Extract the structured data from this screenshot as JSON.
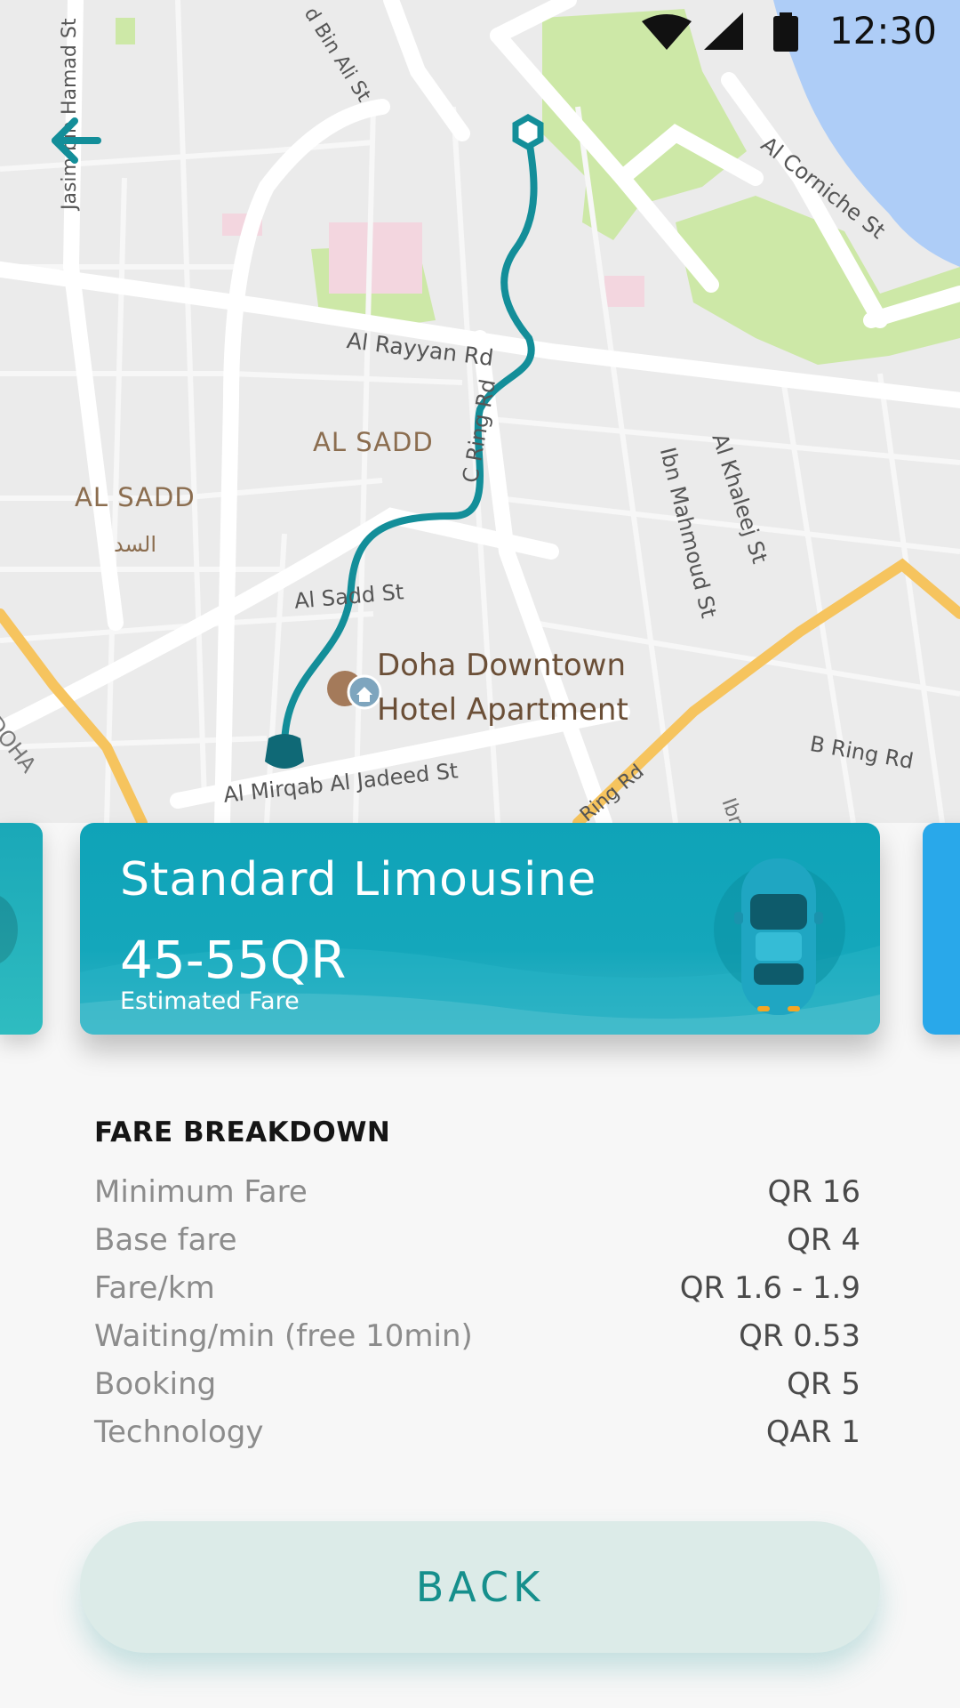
{
  "status": {
    "time": "12:30"
  },
  "map": {
    "labels": {
      "al_sadd_1": "AL SADD",
      "al_sadd_2": "AL SADD",
      "al_sadd_ar": "السد",
      "al_rayyan_rd": "Al Rayyan Rd",
      "al_sadd_st": "Al Sadd St",
      "c_ring_rd": "C Ring Rd",
      "ibn_mahmoud_st": "Ibn Mahmoud St",
      "al_khaleej_st": "Al Khaleej St",
      "al_corniche_st": "Al Corniche St",
      "b_ring_rd": "B Ring Rd",
      "al_mirqab": "Al Mirqab Al Jadeed St",
      "jasim_st": "Jasim bin Hamad St",
      "bin_ali_st": "d Bin Ali St",
      "doha": "DOHA",
      "poi_line1": "Doha Downtown",
      "poi_line2": "Hotel Apartment",
      "ring_rd_partial": "Ring Rd",
      "ibn_partial": "Ibn"
    },
    "colors": {
      "route": "#138e99",
      "park": "#cde8a7",
      "water": "#aecdf7",
      "major_road": "#f6c45e"
    }
  },
  "ride": {
    "title": "Standard Limousine",
    "price": "45-55QR",
    "subtitle": "Estimated Fare",
    "color": "#0fa3b8"
  },
  "breakdown": {
    "title": "FARE BREAKDOWN",
    "rows": [
      {
        "label": "Minimum Fare",
        "value": "QR 16"
      },
      {
        "label": "Base fare",
        "value": "QR 4"
      },
      {
        "label": "Fare/km",
        "value": "QR 1.6 - 1.9"
      },
      {
        "label": "Waiting/min (free 10min)",
        "value": "QR 0.53"
      },
      {
        "label": "Booking",
        "value": "QR 5"
      },
      {
        "label": "Technology",
        "value": "QAR 1"
      }
    ]
  },
  "actions": {
    "back_label": "BACK"
  },
  "icons": {
    "back": "arrow-left-icon",
    "car": "car-top-icon",
    "wifi": "wifi-icon",
    "signal": "signal-icon",
    "battery": "battery-icon"
  }
}
